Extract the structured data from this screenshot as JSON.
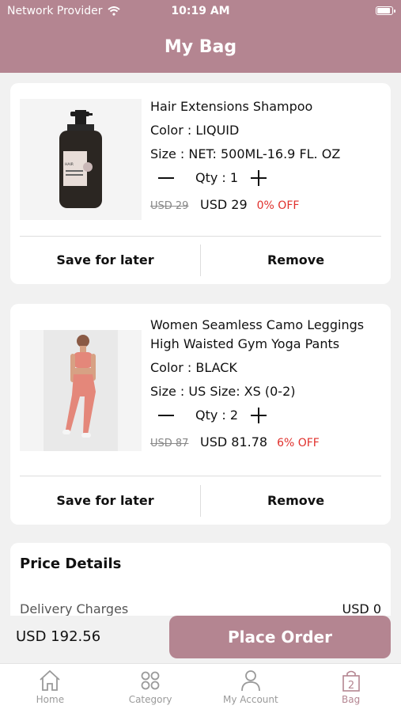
{
  "status": {
    "carrier": "Network Provider",
    "time": "10:19 AM"
  },
  "header": {
    "title": "My Bag"
  },
  "items": [
    {
      "name": "Hair Extensions Shampoo",
      "color": "Color : LIQUID",
      "size": "Size : NET: 500ML-16.9 FL. OZ",
      "qty": "Qty : 1",
      "old_price": "USD 29",
      "price": "USD 29",
      "discount": "0% OFF",
      "save_label": "Save for later",
      "remove_label": "Remove",
      "bottle_label": "HAIR EXTENSIONS SHAMPOO"
    },
    {
      "name_line1": "Women Seamless Camo Leggings",
      "name_line2": "High Waisted Gym Yoga Pants",
      "color": "Color : BLACK",
      "size": "Size : US Size:  XS (0-2)",
      "qty": "Qty : 2",
      "old_price": "USD 87",
      "price": "USD 81.78",
      "discount": "6% OFF",
      "save_label": "Save for later",
      "remove_label": "Remove"
    }
  ],
  "price_details": {
    "title": "Price Details",
    "delivery_label": "Delivery Charges",
    "delivery_value": "USD 0"
  },
  "footer": {
    "total": "USD 192.56",
    "place_order": "Place Order"
  },
  "tabs": [
    {
      "label": "Home",
      "icon": "home-icon"
    },
    {
      "label": "Category",
      "icon": "category-icon"
    },
    {
      "label": "My Account",
      "icon": "account-icon"
    },
    {
      "label": "Bag",
      "icon": "bag-icon",
      "badge": "2",
      "active": true
    }
  ],
  "colors": {
    "accent": "#b48591",
    "discount": "#e0302c"
  }
}
